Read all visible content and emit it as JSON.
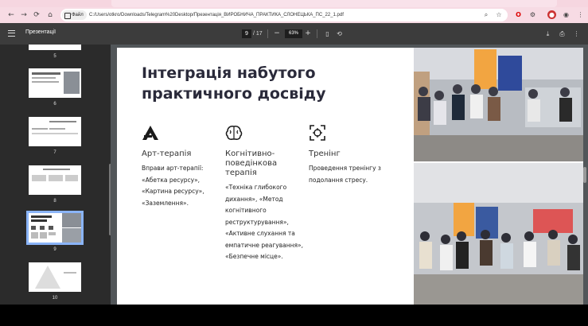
{
  "browser": {
    "nav": {
      "back": "←",
      "forward": "→",
      "reload": "⟳",
      "home": "⌂"
    },
    "chip_label": "Файл",
    "url": "C:/Users/otkro/Downloads/Telegram%20Desktop/Презентація_ВИРОБНИЧА_ПРАКТИКА_СЛОНЕЦЬКА_ПС_22_1.pdf",
    "icons": [
      "search-icon",
      "star-icon",
      "opera-icon",
      "extension-icon",
      "profile-icon",
      "menu-icon"
    ]
  },
  "pdf_toolbar": {
    "title": "Презентації",
    "page_current": "9",
    "page_total": "/ 17",
    "zoom_minus": "−",
    "zoom": "63%",
    "zoom_plus": "+",
    "icons": {
      "fit": "▯",
      "rotate": "⟲",
      "download": "⤓",
      "print": "⎙",
      "more": "⋮"
    }
  },
  "sidebar": {
    "pages": [
      "5",
      "6",
      "7",
      "8",
      "9",
      "10"
    ],
    "active_page": "9"
  },
  "slide": {
    "title": "Інтеграція набутого практичного досвіду",
    "columns": [
      {
        "icon": "art-triangle-icon",
        "heading": "Арт-терапія",
        "body": "Вправи арт-терапії: «Абетка ресурсу», «Картина ресурсу», «Заземлення»."
      },
      {
        "icon": "brain-icon",
        "heading": "Когнітивно-поведінкова терапія",
        "body": "«Техніка глибокого дихання», «Метод когнітивного реструктурування», «Активне слухання та емпатичне реагування», «Безпечне місце»."
      },
      {
        "icon": "focus-frame-icon",
        "heading": "Тренінг",
        "body": "Проведення тренінгу з подолання стресу."
      }
    ],
    "photos": [
      "photo-training-group-1",
      "photo-training-group-2"
    ]
  }
}
